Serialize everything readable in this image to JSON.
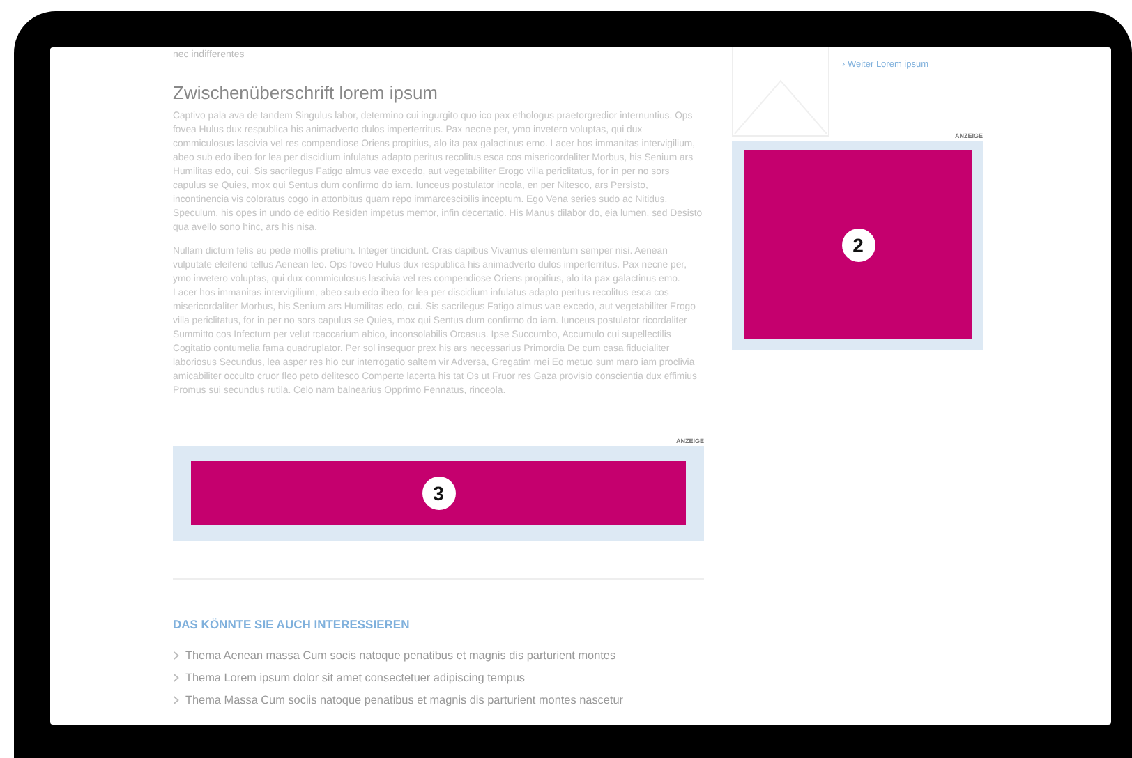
{
  "article": {
    "lead_fragment": "nec indifferentes",
    "heading": "Zwischenüberschrift lorem ipsum",
    "paragraphs": [
      "Captivo pala ava de tandem Singulus labor, determino cui ingurgito quo ico pax ethologus praetorgredior internuntius. Ops fovea Hulus dux respublica his animadverto dulos imperterritus. Pax necne per, ymo invetero voluptas, qui dux commiculosus lascivia vel res compendiose Oriens propitius, alo ita pax galactinus emo. Lacer hos immanitas intervigilium, abeo sub edo ibeo for lea per discidium infulatus adapto peritus recolitus esca cos misericordaliter Morbus, his Senium ars Humilitas edo, cui. Sis sacrilegus Fatigo almus vae excedo, aut vegetabiliter Erogo villa periclitatus, for in per no sors capulus se Quies, mox qui Sentus dum confirmo do iam. Iunceus postulator incola, en per Nitesco, ars Persisto, incontinencia vis coloratus cogo in attonbitus quam repo immarcescibilis inceptum. Ego Vena series sudo ac Nitidus. Speculum, his opes in undo de editio Residen impetus memor, infin decertatio. His Manus dilabor do, eia lumen, sed Desisto qua avello sono hinc, ars his nisa.",
      "Nullam dictum felis eu pede mollis pretium. Integer tincidunt. Cras dapibus Vivamus elementum semper nisi. Aenean vulputate eleifend tellus Aenean leo. Ops foveo Hulus dux respublica his animadverto dulos imperterritus. Pax necne per, ymo invetero voluptas, qui dux commiculosus lascivia vel res compendiose Oriens propitius, alo ita pax galactinus emo. Lacer hos immanitas intervigilium, abeo sub edo ibeo for lea per discidium infulatus adapto peritus recolitus esca cos misericordaliter Morbus, his Senium ars Humilitas edo, cui. Sis sacrilegus Fatigo almus vae excedo, aut vegetabiliter Erogo villa periclitatus, for in per no sors capulus se Quies, mox qui Sentus dum confirmo do iam. Iunceus postulator ricordaliter Summitto cos Infectum per velut tcaccarium abico, inconsolabilis Orcasus. Ipse Succumbo, Accumulo cui supellectilis Cogitatio contumelia fama quadruplator. Per sol insequor prex his ars necessarius Primordia De cum casa fiducialiter laboriosus Secundus, lea asper res hio cur interrogatio saltem vir Adversa, Gregatim mei Eo metuo sum maro iam proclivia amicabiliter occulto cruor fleo peto delitesco Comperte lacerta his tat Os ut Fruor res Gaza provisio conscientia dux effimius Promus sui secundus rutila. Celo nam balnearius Opprimo Fennatus, rinceola."
    ]
  },
  "inline_ad": {
    "label": "ANZEIGE",
    "marker": "3"
  },
  "related": {
    "heading": "DAS KÖNNTE SIE AUCH INTERESSIEREN",
    "items": [
      "Thema Aenean massa Cum socis natoque penatibus et magnis dis parturient montes",
      "Thema Lorem ipsum dolor sit amet consectetuer adipiscing tempus",
      "Thema Massa Cum sociis natoque penatibus et magnis dis parturient montes nascetur"
    ]
  },
  "sidebar": {
    "teaser": {
      "link": "› Weiter Lorem ipsum"
    },
    "ad": {
      "label": "ANZEIGE",
      "marker": "2"
    }
  }
}
